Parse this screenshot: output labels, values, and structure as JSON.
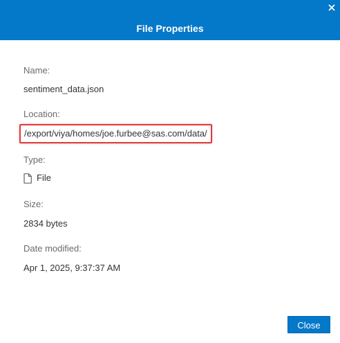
{
  "dialog": {
    "title": "File Properties",
    "close_icon": "close-icon"
  },
  "fields": {
    "name_label": "Name:",
    "name_value": "sentiment_data.json",
    "location_label": "Location:",
    "location_value": "/export/viya/homes/joe.furbee@sas.com/data/",
    "type_label": "Type:",
    "type_icon": "file-icon",
    "type_value": "File",
    "size_label": "Size:",
    "size_value": "2834 bytes",
    "date_label": "Date modified:",
    "date_value": "Apr 1, 2025, 9:37:37 AM"
  },
  "footer": {
    "close_label": "Close"
  },
  "colors": {
    "header": "#0478c9",
    "highlight": "#e0393a"
  }
}
